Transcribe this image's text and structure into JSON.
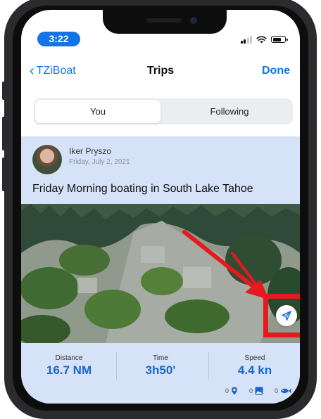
{
  "status_bar": {
    "time": "3:22"
  },
  "nav": {
    "back_label": "TZiBoat",
    "title": "Trips",
    "done_label": "Done"
  },
  "segments": {
    "you": "You",
    "following": "Following"
  },
  "post": {
    "user_name": "Iker Pryszo",
    "date": "Friday, July 2, 2021",
    "title": "Friday Morning boating in South Lake Tahoe"
  },
  "stats": {
    "distance": {
      "label": "Distance",
      "value": "16.7 NM"
    },
    "time": {
      "label": "Time",
      "value": "3h50'"
    },
    "speed": {
      "label": "Speed",
      "value": "4.4 kn"
    }
  },
  "counts": {
    "waypoints": "0",
    "photos": "0",
    "fish": "0"
  },
  "icons": {
    "share": "share-icon",
    "waypoint": "map-pin-icon",
    "photo": "photo-icon",
    "fish": "fish-icon",
    "back": "chevron-left-icon"
  },
  "colors": {
    "accent": "#1473e6",
    "card_background": "#d5e2f7",
    "annotation": "#e5191e"
  }
}
